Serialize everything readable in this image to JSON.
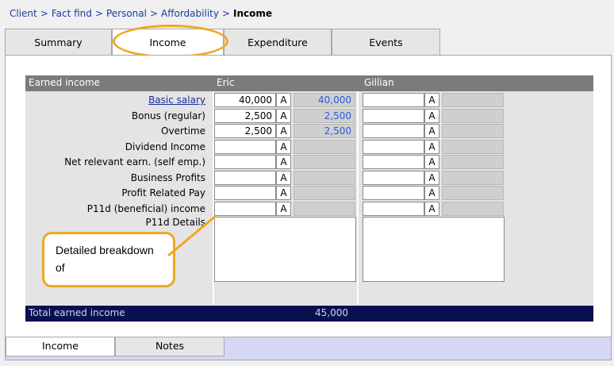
{
  "breadcrumb": {
    "items": [
      "Client",
      "Fact find",
      "Personal",
      "Affordability"
    ],
    "current": "Income",
    "separator": ">"
  },
  "tabs": [
    {
      "label": "Summary"
    },
    {
      "label": "Income",
      "active": true
    },
    {
      "label": "Expenditure"
    },
    {
      "label": "Events"
    }
  ],
  "section": {
    "title": "Earned income",
    "person1": "Eric",
    "person2": "Gillian"
  },
  "rows": [
    {
      "label": "Basic salary",
      "link": true,
      "eric_value": "40,000",
      "eric_flag": "A",
      "eric_calc": "40,000",
      "gillian_value": "",
      "gillian_flag": "A"
    },
    {
      "label": "Bonus (regular)",
      "eric_value": "2,500",
      "eric_flag": "A",
      "eric_calc": "2,500",
      "gillian_value": "",
      "gillian_flag": "A"
    },
    {
      "label": "Overtime",
      "eric_value": "2,500",
      "eric_flag": "A",
      "eric_calc": "2,500",
      "gillian_value": "",
      "gillian_flag": "A"
    },
    {
      "label": "Dividend Income",
      "eric_value": "",
      "eric_flag": "A",
      "eric_calc": "",
      "gillian_value": "",
      "gillian_flag": "A"
    },
    {
      "label": "Net relevant earn. (self emp.)",
      "eric_value": "",
      "eric_flag": "A",
      "eric_calc": "",
      "gillian_value": "",
      "gillian_flag": "A"
    },
    {
      "label": "Business Profits",
      "eric_value": "",
      "eric_flag": "A",
      "eric_calc": "",
      "gillian_value": "",
      "gillian_flag": "A"
    },
    {
      "label": "Profit Related Pay",
      "eric_value": "",
      "eric_flag": "A",
      "eric_calc": "",
      "gillian_value": "",
      "gillian_flag": "A"
    },
    {
      "label": "P11d (beneficial) income",
      "eric_value": "",
      "eric_flag": "A",
      "eric_calc": "",
      "gillian_value": "",
      "gillian_flag": "A"
    }
  ],
  "p11d_details_label": "P11d Details",
  "total": {
    "label": "Total earned income",
    "eric": "45,000",
    "gillian": ""
  },
  "callout": {
    "text": "Detailed breakdown of"
  },
  "bottom_tabs": [
    {
      "label": "Income",
      "active": true
    },
    {
      "label": "Notes"
    }
  ],
  "colors": {
    "accent_highlight": "#f0a820",
    "total_bar": "#0a0f4f",
    "header_bar": "#7b7b7b",
    "link": "#1a3d9c",
    "calc_value": "#2a5bd7"
  }
}
